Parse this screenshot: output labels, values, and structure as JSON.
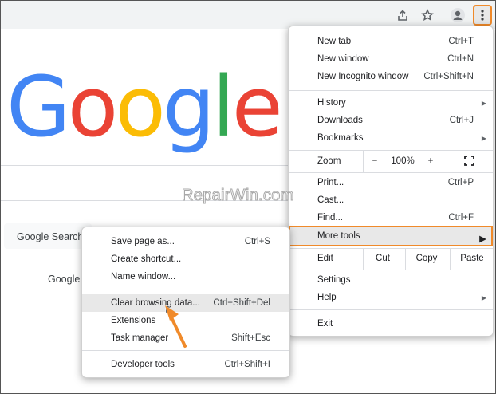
{
  "colors": {
    "accent": "#f08a2a",
    "google_blue": "#4285f4",
    "google_red": "#ea4335",
    "google_yellow": "#fbbc05",
    "google_green": "#34a853"
  },
  "toolbar": {
    "icons": [
      "share-icon",
      "star-icon",
      "profile-icon",
      "more-vert-icon"
    ]
  },
  "logo_text": "Google",
  "page": {
    "search_button": "Google Search",
    "lang_link": "Google"
  },
  "watermark": "RepairWin.com",
  "main_menu": {
    "new_tab": {
      "label": "New tab",
      "shortcut": "Ctrl+T"
    },
    "new_window": {
      "label": "New window",
      "shortcut": "Ctrl+N"
    },
    "new_incognito": {
      "label": "New Incognito window",
      "shortcut": "Ctrl+Shift+N"
    },
    "history": {
      "label": "History"
    },
    "downloads": {
      "label": "Downloads",
      "shortcut": "Ctrl+J"
    },
    "bookmarks": {
      "label": "Bookmarks"
    },
    "zoom": {
      "label": "Zoom",
      "minus": "−",
      "value": "100%",
      "plus": "+"
    },
    "print": {
      "label": "Print...",
      "shortcut": "Ctrl+P"
    },
    "cast": {
      "label": "Cast..."
    },
    "find": {
      "label": "Find...",
      "shortcut": "Ctrl+F"
    },
    "more_tools": {
      "label": "More tools"
    },
    "edit": {
      "label": "Edit",
      "cut": "Cut",
      "copy": "Copy",
      "paste": "Paste"
    },
    "settings": {
      "label": "Settings"
    },
    "help": {
      "label": "Help"
    },
    "exit": {
      "label": "Exit"
    }
  },
  "more_tools_menu": {
    "save_page": {
      "label": "Save page as...",
      "shortcut": "Ctrl+S"
    },
    "create_shortcut": {
      "label": "Create shortcut..."
    },
    "name_window": {
      "label": "Name window..."
    },
    "clear_data": {
      "label": "Clear browsing data...",
      "shortcut": "Ctrl+Shift+Del"
    },
    "extensions": {
      "label": "Extensions"
    },
    "task_manager": {
      "label": "Task manager",
      "shortcut": "Shift+Esc"
    },
    "dev_tools": {
      "label": "Developer tools",
      "shortcut": "Ctrl+Shift+I"
    }
  }
}
